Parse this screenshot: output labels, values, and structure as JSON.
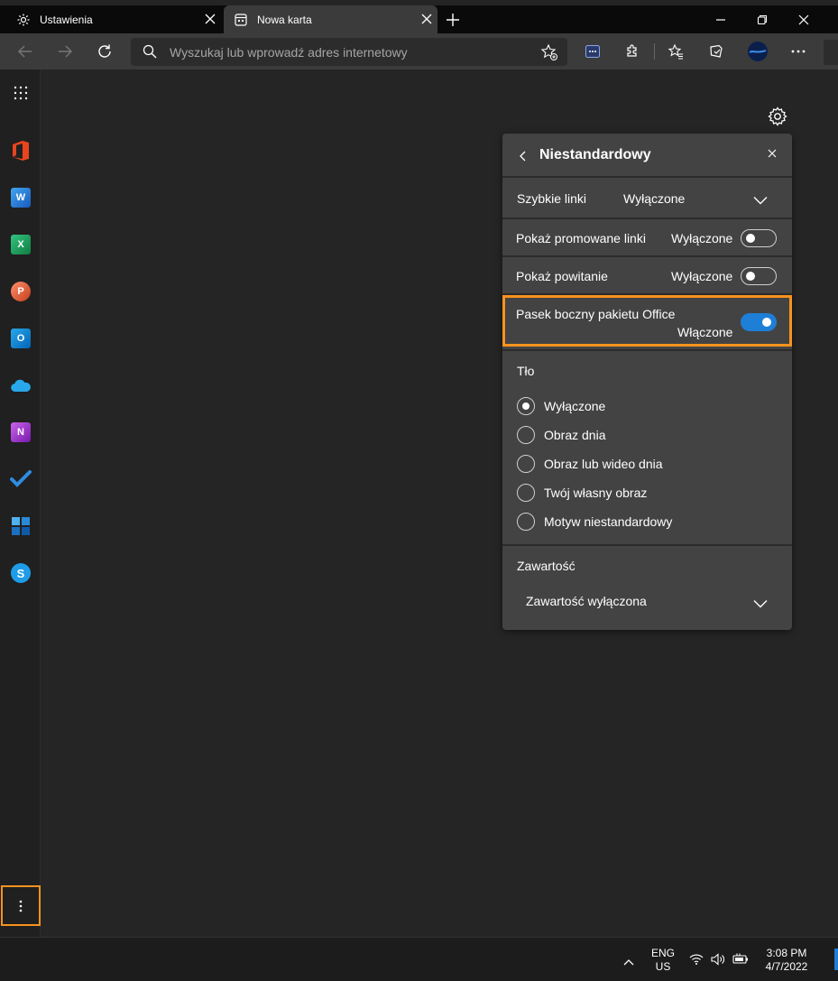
{
  "tabs": [
    {
      "label": "Ustawienia",
      "icon": "gear-icon"
    },
    {
      "label": "Nowa karta",
      "icon": "new-tab-page-icon"
    }
  ],
  "address_bar": {
    "placeholder": "Wyszukaj lub wprowadź adres internetowy"
  },
  "sidebar": {
    "apps": [
      "Office",
      "Word",
      "Excel",
      "PowerPoint",
      "Outlook",
      "OneDrive",
      "OneNote",
      "To Do",
      "Family Safety",
      "Skype"
    ]
  },
  "panel": {
    "title": "Niestandardowy",
    "quick_links": {
      "label": "Szybkie linki",
      "value": "Wyłączone"
    },
    "promoted_links": {
      "label": "Pokaż promowane linki",
      "value": "Wyłączone",
      "enabled": false
    },
    "greeting": {
      "label": "Pokaż powitanie",
      "value": "Wyłączone",
      "enabled": false
    },
    "office_sidebar": {
      "label": "Pasek boczny pakietu Office",
      "value": "Włączone",
      "enabled": true
    },
    "background": {
      "heading": "Tło",
      "options": [
        "Wyłączone",
        "Obraz dnia",
        "Obraz lub wideo dnia",
        "Twój własny obraz",
        "Motyw niestandardowy"
      ],
      "selected": "Wyłączone"
    },
    "content": {
      "heading": "Zawartość",
      "value": "Zawartość wyłączona"
    }
  },
  "taskbar": {
    "lang_top": "ENG",
    "lang_bottom": "US",
    "time": "3:08 PM",
    "date": "4/7/2022"
  },
  "colors": {
    "highlight": "#f7931e",
    "toggle_on": "#1e7fd6"
  }
}
